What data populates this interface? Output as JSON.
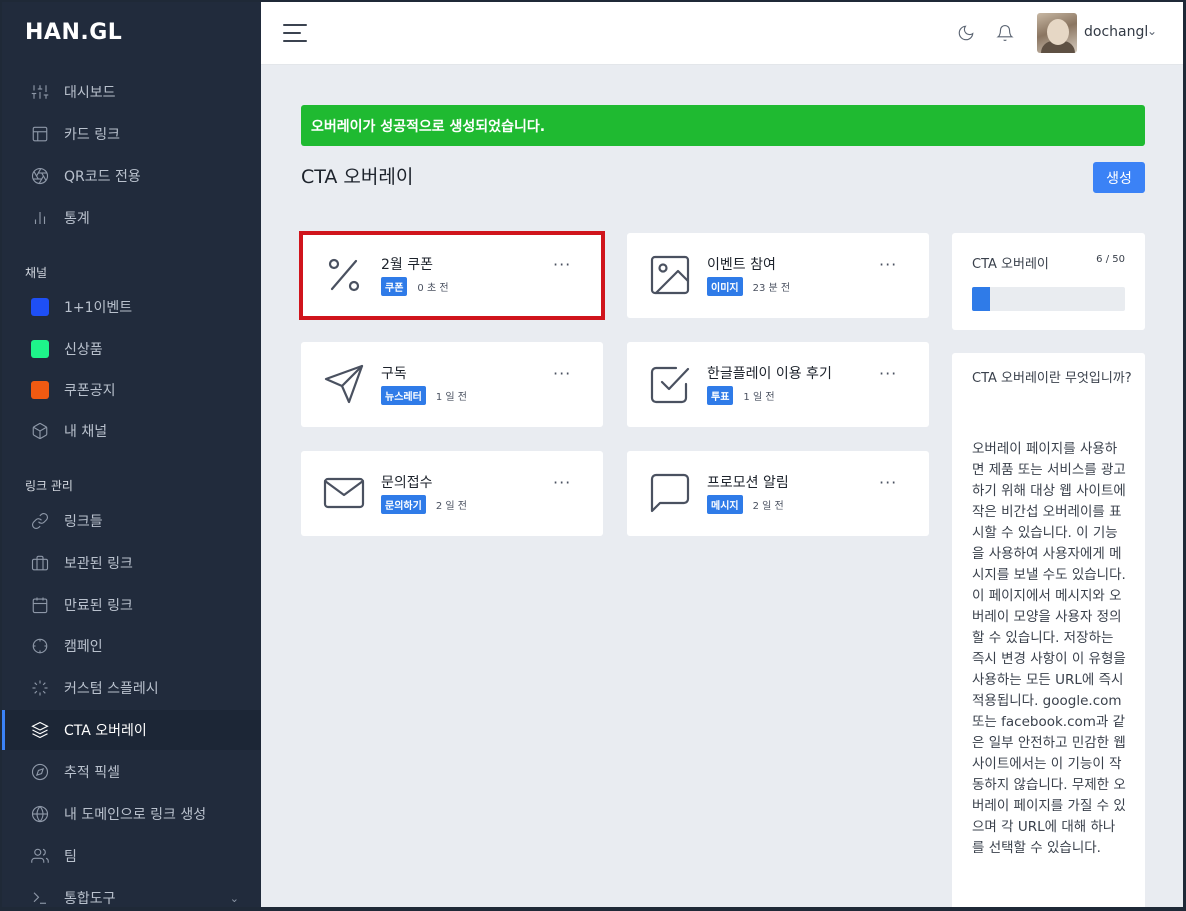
{
  "app": {
    "logo": "HAN.GL"
  },
  "sidebar": {
    "top_items": [
      {
        "label": "대시보드",
        "icon": "sliders-icon"
      },
      {
        "label": "카드 링크",
        "icon": "layout-icon"
      },
      {
        "label": "QR코드 전용",
        "icon": "aperture-icon"
      },
      {
        "label": "통계",
        "icon": "bar-chart-icon"
      }
    ],
    "channels_label": "채널",
    "channels": [
      {
        "label": "1+1이벤트",
        "color": "#1e4ff5"
      },
      {
        "label": "신상품",
        "color": "#1ef58a"
      },
      {
        "label": "쿠폰공지",
        "color": "#f05a12"
      },
      {
        "label": "내 채널",
        "icon": "box-icon"
      }
    ],
    "links_label": "링크 관리",
    "link_items": [
      {
        "label": "링크들",
        "icon": "link-icon"
      },
      {
        "label": "보관된 링크",
        "icon": "briefcase-icon"
      },
      {
        "label": "만료된 링크",
        "icon": "calendar-icon"
      },
      {
        "label": "캠페인",
        "icon": "crosshair-icon"
      },
      {
        "label": "커스텀 스플레시",
        "icon": "loader-icon"
      },
      {
        "label": "CTA 오버레이",
        "icon": "layers-icon"
      },
      {
        "label": "추적 픽셀",
        "icon": "compass-icon"
      },
      {
        "label": "내 도메인으로 링크 생성",
        "icon": "globe-icon"
      },
      {
        "label": "팀",
        "icon": "users-icon"
      },
      {
        "label": "통합도구",
        "icon": "terminal-icon"
      }
    ]
  },
  "topbar": {
    "username": "dochangl"
  },
  "alert": {
    "message": "오버레이가 성공적으로 생성되었습니다."
  },
  "page": {
    "title": "CTA 오버레이",
    "create_label": "생성"
  },
  "cards": [
    {
      "title": "2월 쿠폰",
      "badge": "쿠폰",
      "time": "0 초 전",
      "icon": "percent-icon"
    },
    {
      "title": "이벤트 참여",
      "badge": "이미지",
      "time": "23 분 전",
      "icon": "image-icon"
    },
    {
      "title": "구독",
      "badge": "뉴스레터",
      "time": "1 일 전",
      "icon": "send-icon"
    },
    {
      "title": "한글플레이 이용 후기",
      "badge": "투표",
      "time": "1 일 전",
      "icon": "check-square-icon"
    },
    {
      "title": "문의접수",
      "badge": "문의하기",
      "time": "2 일 전",
      "icon": "mail-icon"
    },
    {
      "title": "프로모션 알림",
      "badge": "메시지",
      "time": "2 일 전",
      "icon": "message-square-icon"
    }
  ],
  "stats": {
    "title": "CTA 오버레이",
    "count": "6 / 50",
    "fill_fraction": 0.12,
    "accent": "#2f7be8"
  },
  "info": {
    "question": "CTA 오버레이란 무엇입니까?",
    "answer": "오버레이 페이지를 사용하면 제품 또는 서비스를 광고하기 위해 대상 웹 사이트에 작은 비간섭 오버레이를 표시할 수 있습니다. 이 기능을 사용하여 사용자에게 메시지를 보낼 수도 있습니다. 이 페이지에서 메시지와 오버레이 모양을 사용자 정의할 수 있습니다. 저장하는 즉시 변경 사항이 이 유형을 사용하는 모든 URL에 즉시 적용됩니다. google.com 또는 facebook.com과 같은 일부 안전하고 민감한 웹사이트에서는 이 기능이 작동하지 않습니다. 무제한 오버레이 페이지를 가질 수 있으며 각 URL에 대해 하나를 선택할 수 있습니다."
  }
}
